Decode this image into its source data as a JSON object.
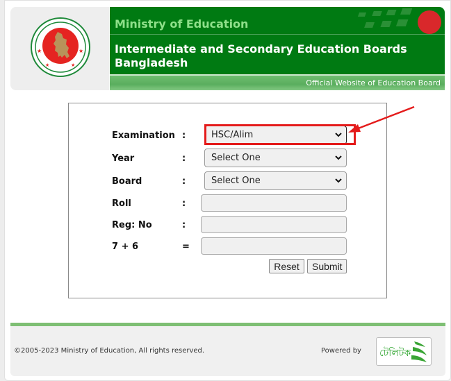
{
  "header": {
    "ministry": "Ministry of Education",
    "board_title": "Intermediate and Secondary Education Boards Bangladesh",
    "tagline": "Official Website of Education Board",
    "seal_icon": "government-seal-icon"
  },
  "form": {
    "rows": [
      {
        "label": "Examination",
        "separator": ":",
        "type": "select",
        "value": "HSC/Alim"
      },
      {
        "label": "Year",
        "separator": ":",
        "type": "select",
        "value": "Select One"
      },
      {
        "label": "Board",
        "separator": ":",
        "type": "select",
        "value": "Select One"
      },
      {
        "label": "Roll",
        "separator": ":",
        "type": "input",
        "value": ""
      },
      {
        "label": "Reg: No",
        "separator": ":",
        "type": "input",
        "value": ""
      },
      {
        "label": "7 + 6",
        "separator": "=",
        "type": "input",
        "value": ""
      }
    ],
    "reset_label": "Reset",
    "submit_label": "Submit"
  },
  "annotation": {
    "highlight_color": "#e41b1b",
    "target": "Examination select"
  },
  "footer": {
    "copyright": "©2005-2023 Ministry of Education, All rights reserved.",
    "powered_by": "Powered by",
    "partner_logo_text": "টেলিটক"
  },
  "colors": {
    "brand_green": "#007a12",
    "accent_green": "#7ebf74",
    "ministry_text": "#8fe08a"
  }
}
